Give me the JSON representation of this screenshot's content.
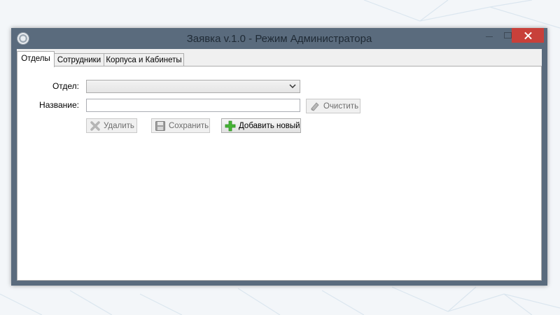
{
  "colors": {
    "desktop_bg": "#f3f6f9",
    "window_frame": "#5a6b7d",
    "close_button": "#c8403a",
    "add_icon": "#46b535"
  },
  "window": {
    "title": "Заявка v.1.0 - Режим Администратора",
    "icon": "app-disc-icon"
  },
  "tabs": [
    {
      "label": "Отделы",
      "active": true
    },
    {
      "label": "Сотрудники",
      "active": false
    },
    {
      "label": "Корпуса и Кабинеты",
      "active": false
    }
  ],
  "form": {
    "department_label": "Отдел:",
    "department_value": "",
    "name_label": "Название:",
    "name_value": "",
    "clear_label": "Очистить",
    "delete_label": "Удалить",
    "save_label": "Сохранить",
    "add_label": "Добавить новый"
  },
  "icons": {
    "clear": "eraser-icon",
    "delete": "delete-x-icon",
    "save": "floppy-disk-icon",
    "add": "plus-icon",
    "dropdown": "chevron-down-icon"
  }
}
